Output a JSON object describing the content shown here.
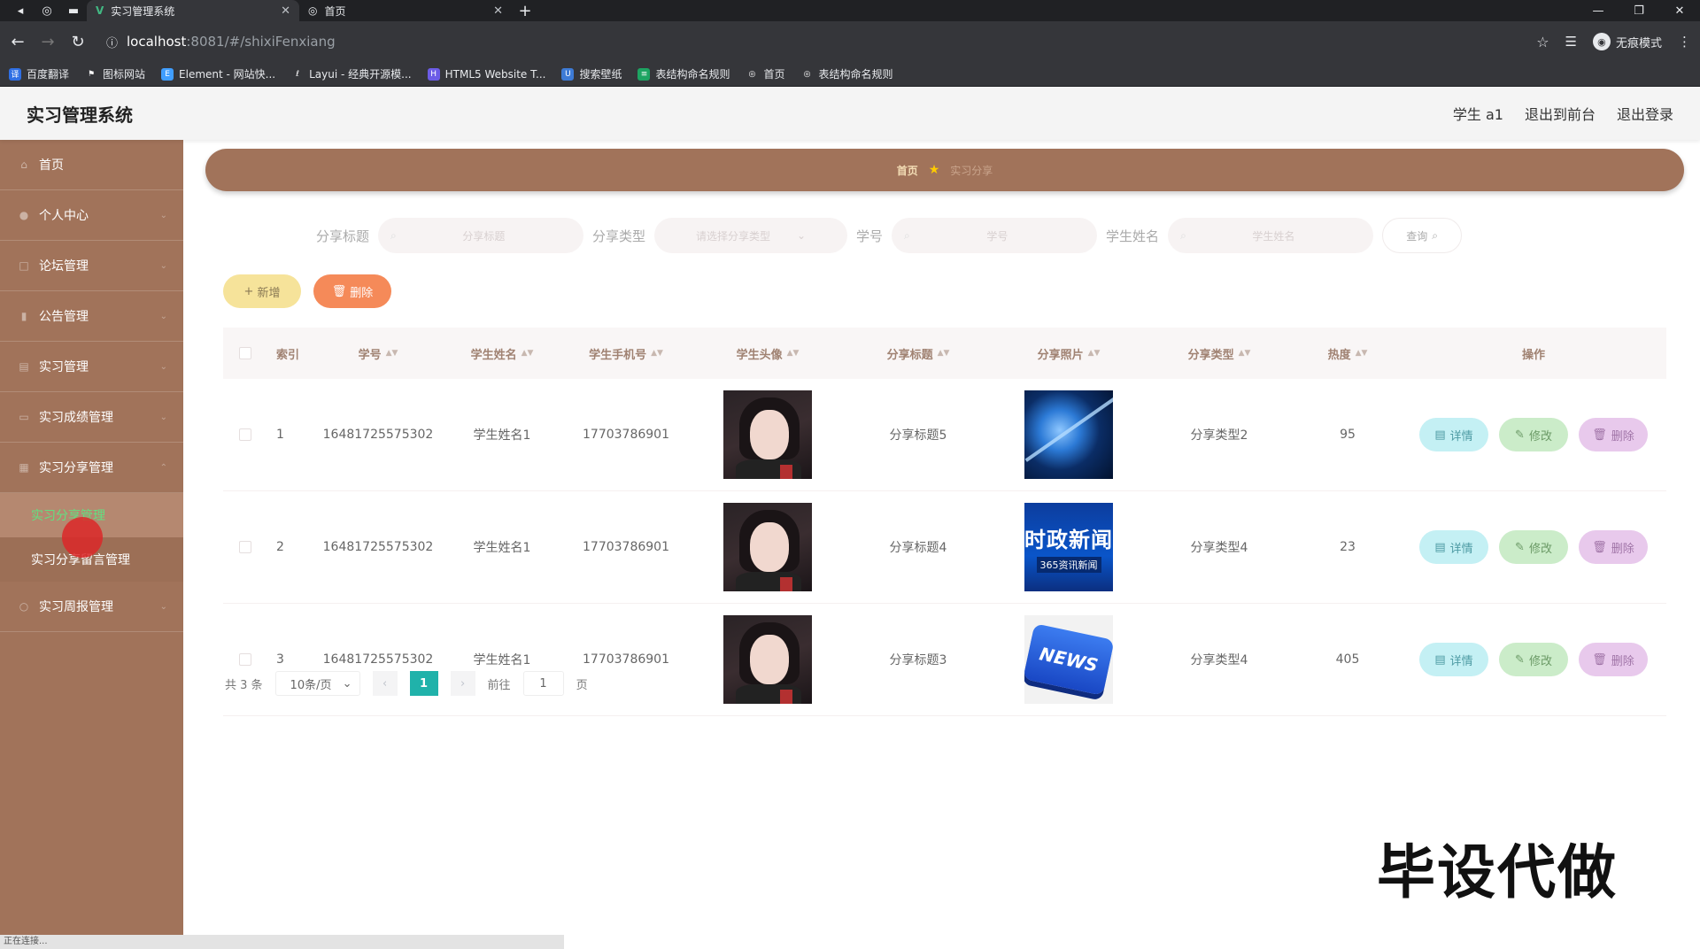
{
  "browser": {
    "tabs": [
      {
        "title": "实习管理系统",
        "active": true
      },
      {
        "title": "首页",
        "active": false
      }
    ],
    "url_host": "localhost",
    "url_path": ":8081/#/shixiFenxiang",
    "incognito_label": "无痕模式",
    "bookmarks": [
      {
        "label": "百度翻译",
        "color": "#2f6fe4"
      },
      {
        "label": "图标网站",
        "color": "#ffffff"
      },
      {
        "label": "Element - 网站快...",
        "color": "#409eff"
      },
      {
        "label": "Layui - 经典开源模...",
        "color": "#999999"
      },
      {
        "label": "HTML5 Website T...",
        "color": "#6c5ce7"
      },
      {
        "label": "搜索壁纸",
        "color": "#3d7bd6"
      },
      {
        "label": "表结构命名规则",
        "color": "#1da462"
      },
      {
        "label": "首页",
        "color": "#ffffff"
      },
      {
        "label": "表结构命名规则",
        "color": "#ffffff"
      }
    ]
  },
  "header": {
    "title": "实习管理系统",
    "user": "学生 a1",
    "back_front": "退出到前台",
    "logout": "退出登录"
  },
  "sidebar": {
    "items": [
      {
        "label": "首页",
        "icon": "home-icon"
      },
      {
        "label": "个人中心",
        "icon": "user-icon"
      },
      {
        "label": "论坛管理",
        "icon": "forum-icon"
      },
      {
        "label": "公告管理",
        "icon": "notice-icon"
      },
      {
        "label": "实习管理",
        "icon": "doc-icon"
      },
      {
        "label": "实习成绩管理",
        "icon": "grade-icon"
      },
      {
        "label": "实习分享管理",
        "icon": "share-icon"
      }
    ],
    "subitems": [
      {
        "label": "实习分享管理",
        "active": true
      },
      {
        "label": "实习分享留言管理",
        "active": false
      }
    ],
    "last_item": {
      "label": "实习周报管理",
      "icon": "report-icon"
    },
    "status_text": "正在连接..."
  },
  "breadcrumb": {
    "home": "首页",
    "current": "实习分享"
  },
  "search": {
    "title_label": "分享标题",
    "title_placeholder": "分享标题",
    "type_label": "分享类型",
    "type_placeholder": "请选择分享类型",
    "id_label": "学号",
    "id_placeholder": "学号",
    "name_label": "学生姓名",
    "name_placeholder": "学生姓名",
    "query_button": "查询"
  },
  "actions": {
    "add": "新增",
    "delete": "删除"
  },
  "table": {
    "headers": {
      "index": "索引",
      "student_id": "学号",
      "name": "学生姓名",
      "phone": "学生手机号",
      "avatar": "学生头像",
      "title": "分享标题",
      "photo": "分享照片",
      "type": "分享类型",
      "hot": "热度",
      "ops": "操作"
    },
    "rows": [
      {
        "index": "1",
        "student_id": "16481725575302",
        "name": "学生姓名1",
        "phone": "17703786901",
        "title": "分享标题5",
        "photo": "globe",
        "type": "分享类型2",
        "hot": "95"
      },
      {
        "index": "2",
        "student_id": "16481725575302",
        "name": "学生姓名1",
        "phone": "17703786901",
        "title": "分享标题4",
        "photo": "news-banner",
        "type": "分享类型4",
        "hot": "23"
      },
      {
        "index": "3",
        "student_id": "16481725575302",
        "name": "学生姓名1",
        "phone": "17703786901",
        "title": "分享标题3",
        "photo": "news-key",
        "type": "分享类型4",
        "hot": "405"
      }
    ],
    "photo_texts": {
      "news_big": "时政新闻",
      "news_small": "365资讯新闻",
      "key": "NEWS"
    },
    "op_labels": {
      "detail": "详情",
      "edit": "修改",
      "delete": "删除"
    }
  },
  "pagination": {
    "total": "共 3 条",
    "page_size": "10条/页",
    "current_page": "1",
    "goto_label": "前往",
    "goto_value": "1",
    "page_suffix": "页"
  },
  "watermark": "毕设代做"
}
